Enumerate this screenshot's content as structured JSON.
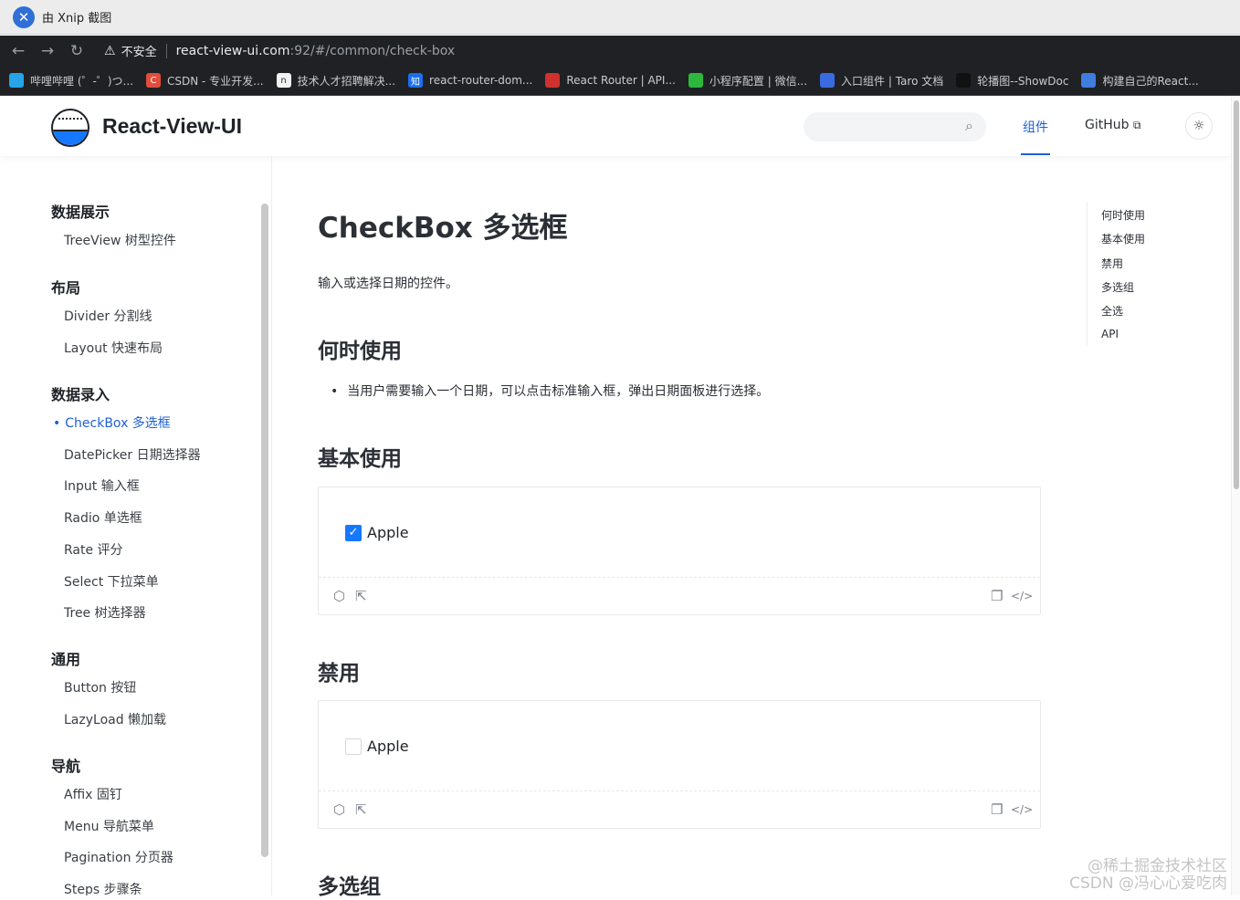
{
  "os": {
    "app_title": "由 Xnip 截图"
  },
  "browser": {
    "insecure_label": "不安全",
    "url_host": "react-view-ui.com",
    "url_rest": ":92/#/common/check-box",
    "bookmarks": [
      {
        "label": "哔哩哔哩 (゜-゜)つ...",
        "icon": "tv-icon",
        "color": "#29a3e8"
      },
      {
        "label": "CSDN - 专业开发...",
        "icon": "C",
        "color": "#e34d3b"
      },
      {
        "label": "技术人才招聘解决...",
        "icon": "n",
        "color": "#f2f2f2"
      },
      {
        "label": "react-router-dom...",
        "icon": "知",
        "color": "#1a6ff0"
      },
      {
        "label": "React Router | API...",
        "icon": "route-icon",
        "color": "#d0312d"
      },
      {
        "label": "小程序配置 | 微信...",
        "icon": "wechat-icon",
        "color": "#2db83d"
      },
      {
        "label": "入口组件 | Taro 文档",
        "icon": "taro-icon",
        "color": "#3a6be0"
      },
      {
        "label": "轮播图--ShowDoc",
        "icon": "feather-icon",
        "color": "#111111"
      },
      {
        "label": "构建自己的React...",
        "icon": "layers-icon",
        "color": "#3f7de0"
      }
    ]
  },
  "header": {
    "brand": "React-View-UI",
    "search_placeholder": "",
    "nav_components": "组件",
    "nav_github": "GitHub",
    "external_glyph": "⧉",
    "theme_glyph": "☼"
  },
  "sidebar": {
    "groups": [
      {
        "title": "数据展示",
        "items": [
          "TreeView 树型控件"
        ]
      },
      {
        "title": "布局",
        "items": [
          "Divider 分割线",
          "Layout 快速布局"
        ]
      },
      {
        "title": "数据录入",
        "items": [
          "CheckBox 多选框",
          "DatePicker 日期选择器",
          "Input 输入框",
          "Radio 单选框",
          "Rate 评分",
          "Select 下拉菜单",
          "Tree 树选择器"
        ]
      },
      {
        "title": "通用",
        "items": [
          "Button 按钮",
          "LazyLoad 懒加载"
        ]
      },
      {
        "title": "导航",
        "items": [
          "Affix 固钉",
          "Menu 导航菜单",
          "Pagination 分页器",
          "Steps 步骤条"
        ]
      }
    ]
  },
  "content": {
    "title": "CheckBox 多选框",
    "description": "输入或选择日期的控件。",
    "section_when": "何时使用",
    "when_bullet": "当用户需要输入一个日期，可以点击标准输入框，弹出日期面板进行选择。",
    "section_basic": "基本使用",
    "basic_checkbox": {
      "label": "Apple",
      "checked": true
    },
    "section_disabled": "禁用",
    "disabled_checkbox": {
      "label": "Apple",
      "checked": false
    },
    "section_group": "多选组"
  },
  "toc": [
    "何时使用",
    "基本使用",
    "禁用",
    "多选组",
    "全选",
    "API"
  ],
  "watermark": {
    "line1": "@稀土掘金技术社区",
    "line2": "CSDN @冯心心爱吃肉"
  },
  "colors": {
    "accent": "#1f5fd8",
    "checkbox_checked": "#1677ff"
  }
}
